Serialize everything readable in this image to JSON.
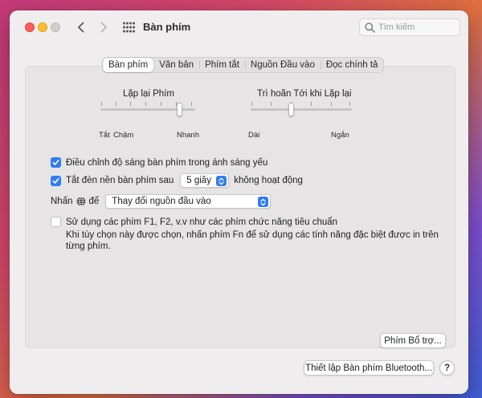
{
  "window": {
    "title": "Bàn phím"
  },
  "search": {
    "placeholder": "Tìm kiếm"
  },
  "tabs": [
    {
      "label": "Bàn phím",
      "active": true
    },
    {
      "label": "Văn bản",
      "active": false
    },
    {
      "label": "Phím tắt",
      "active": false
    },
    {
      "label": "Nguồn Đầu vào",
      "active": false
    },
    {
      "label": "Đọc chính tả",
      "active": false
    }
  ],
  "key_repeat": {
    "title": "Lặp lại Phím",
    "labels": [
      "Tắt",
      "Chậm",
      "Nhanh"
    ],
    "value_fraction": 0.83
  },
  "delay_until_repeat": {
    "title": "Trì hoãn Tới khi Lặp lại",
    "labels": [
      "Dài",
      "Ngắn"
    ],
    "value_fraction": 0.4
  },
  "options": {
    "adjust_brightness": {
      "label": "Điều chỉnh độ sáng bàn phím trong ánh sáng yếu",
      "checked": true
    },
    "backlight_off": {
      "label": "Tắt đèn nền bàn phím sau",
      "checked": true,
      "value": "5 giây",
      "suffix": "không hoạt động"
    },
    "press_globe": {
      "prefix": "Nhấn",
      "mid": "để",
      "value": "Thay đổi nguồn đầu vào"
    },
    "fn_keys": {
      "label": "Sử dụng các phím F1, F2, v.v như các phím chức năng tiêu chuẩn",
      "checked": false,
      "desc_line1": "Khi tùy chọn này được chọn, nhấn phím Fn để sử dụng các tính năng đặc biệt được in trên",
      "desc_line2": "từng phím."
    }
  },
  "buttons": {
    "modifier_keys": "Phím Bổ trợ...",
    "bluetooth_setup": "Thiết lập Bàn phím Bluetooth...",
    "help": "?"
  },
  "colors": {
    "accent": "#2f7cf6",
    "close": "#ff5f57",
    "minimize": "#febc2e"
  }
}
